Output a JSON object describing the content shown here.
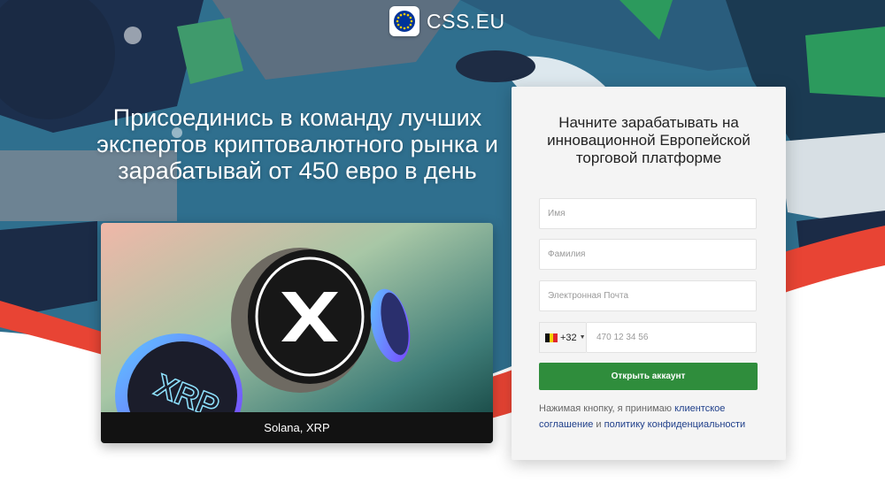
{
  "brand": {
    "name": "CSS.EU",
    "logo_icon": "eu-flag-icon",
    "accent": "#003399"
  },
  "hero": {
    "headline": "Присоединись в команду лучших экспертов криптовалютного рынка и зарабатывай от 450 евро в день",
    "image_caption": "Solana, XRP",
    "coin_label": "XRP"
  },
  "form": {
    "title": "Начните зарабатывать на инновационной Европейской торговой платформе",
    "first_name_placeholder": "Имя",
    "last_name_placeholder": "Фамилия",
    "email_placeholder": "Электронная Почта",
    "country_code": "+32",
    "country_flag": "belgium-flag-icon",
    "phone_placeholder": "470 12 34 56",
    "submit_label": "Открыть аккаунт",
    "submit_color": "#2f8d3c",
    "consent": {
      "prefix": "Нажимая кнопку, я принимаю",
      "terms_link": "клиентское соглашение",
      "conjunction": "и",
      "privacy_link": "политику конфиденциальности"
    }
  }
}
